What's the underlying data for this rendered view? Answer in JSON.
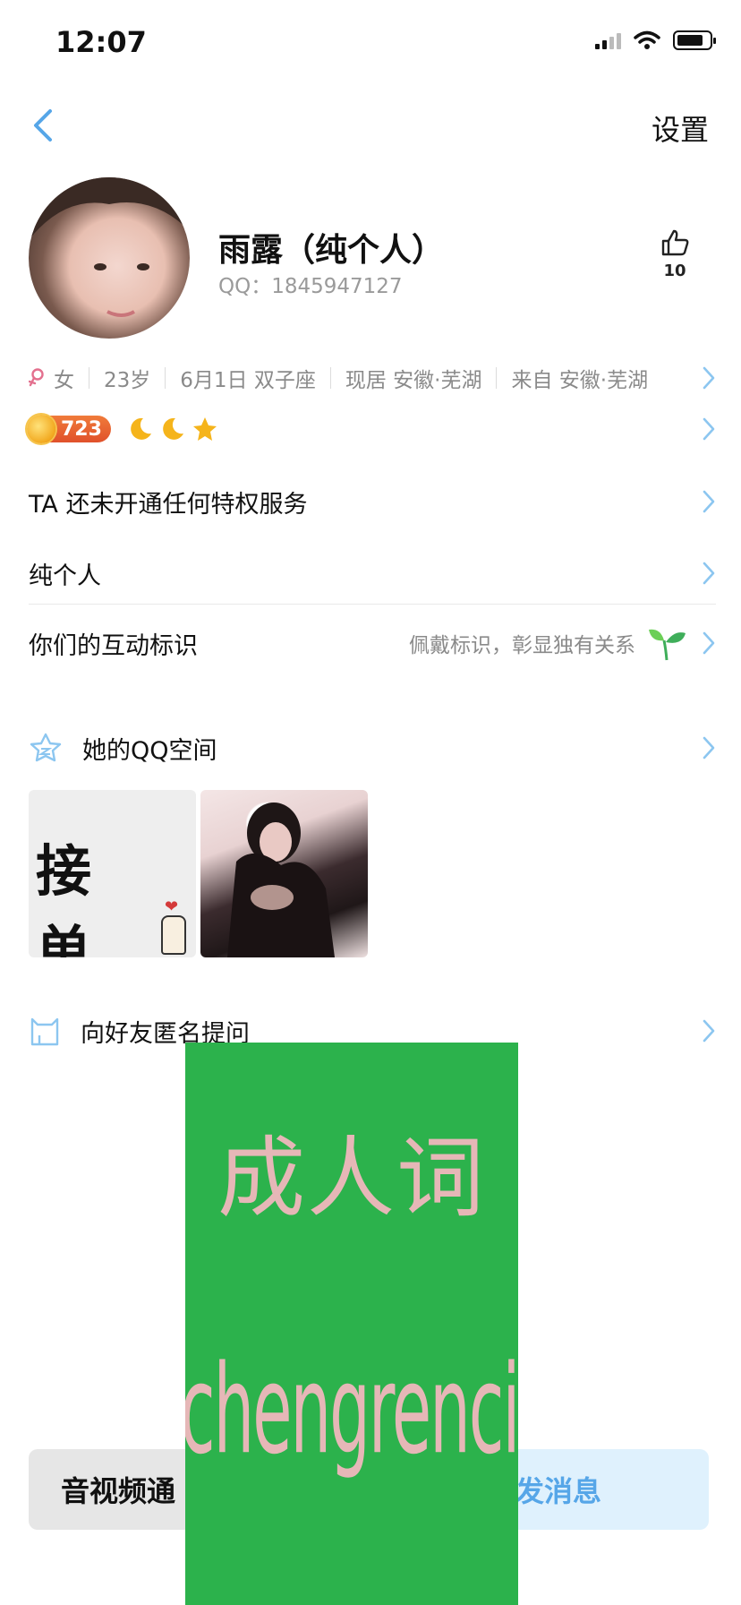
{
  "status_bar": {
    "time": "12:07"
  },
  "nav": {
    "settings_label": "设置"
  },
  "profile": {
    "name": "雨露（纯个人）",
    "qq_label": "QQ：1845947127",
    "likes": "10"
  },
  "info": {
    "gender": "女",
    "age": "23岁",
    "birthday": "6月1日 双子座",
    "residence": "现居 安徽·芜湖",
    "hometown": "来自 安徽·芜湖"
  },
  "level": {
    "badge_value": "723",
    "icons": [
      "moon-icon",
      "moon-icon",
      "star-icon"
    ]
  },
  "rows": {
    "privilege": "TA 还未开通任何特权服务",
    "signature": "纯个人",
    "interaction_label": "你们的互动标识",
    "interaction_hint": "佩戴标识，彰显独有关系"
  },
  "qzone": {
    "title": "她的QQ空间",
    "thumb1_text": "接 单"
  },
  "anon": {
    "title": "向好友匿名提问"
  },
  "bottom": {
    "call_label": "音视频通",
    "message_label": "发消息"
  },
  "watermark": {
    "line1": "成人词",
    "line2": "chengrenci.com"
  },
  "colors": {
    "accent": "#56a6e8",
    "watermark_bg": "#2cb24c",
    "watermark_text": "#e6b7b7",
    "message_bg": "#dff1fd"
  }
}
